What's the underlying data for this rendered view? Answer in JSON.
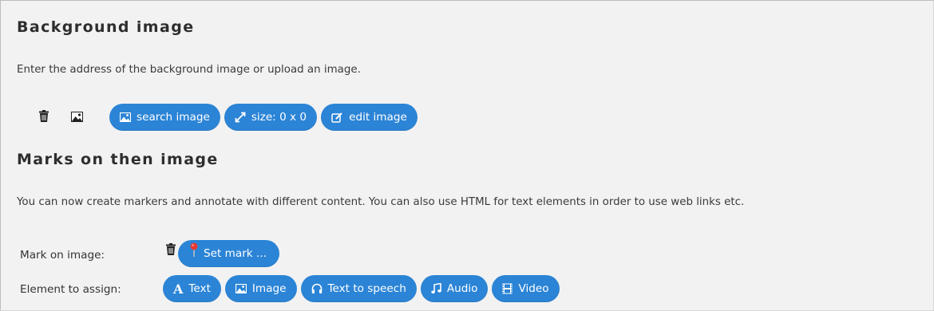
{
  "section1": {
    "heading": "Background image",
    "description": "Enter the address of the background image or upload an image.",
    "buttons": {
      "search": "search image",
      "size": "size: 0 x 0",
      "edit": "edit image"
    }
  },
  "section2": {
    "heading": "Marks on then image",
    "description": "You can now create markers and annotate with different content. You can also use HTML for text elements in order to use web links etc.",
    "mark_label": "Mark on image:",
    "set_mark": "Set mark ...",
    "assign_label": "Element to assign:",
    "elements": {
      "text": "Text",
      "image": "Image",
      "tts": "Text to speech",
      "audio": "Audio",
      "video": "Video"
    }
  },
  "colors": {
    "button": "#2b84d6",
    "pin": "#e53935",
    "background": "#f2f2f2"
  },
  "icons": [
    "trash-icon",
    "image-icon",
    "resize-icon",
    "edit-icon",
    "map-pin-icon",
    "text-icon",
    "headphones-icon",
    "music-note-icon",
    "film-icon"
  ]
}
